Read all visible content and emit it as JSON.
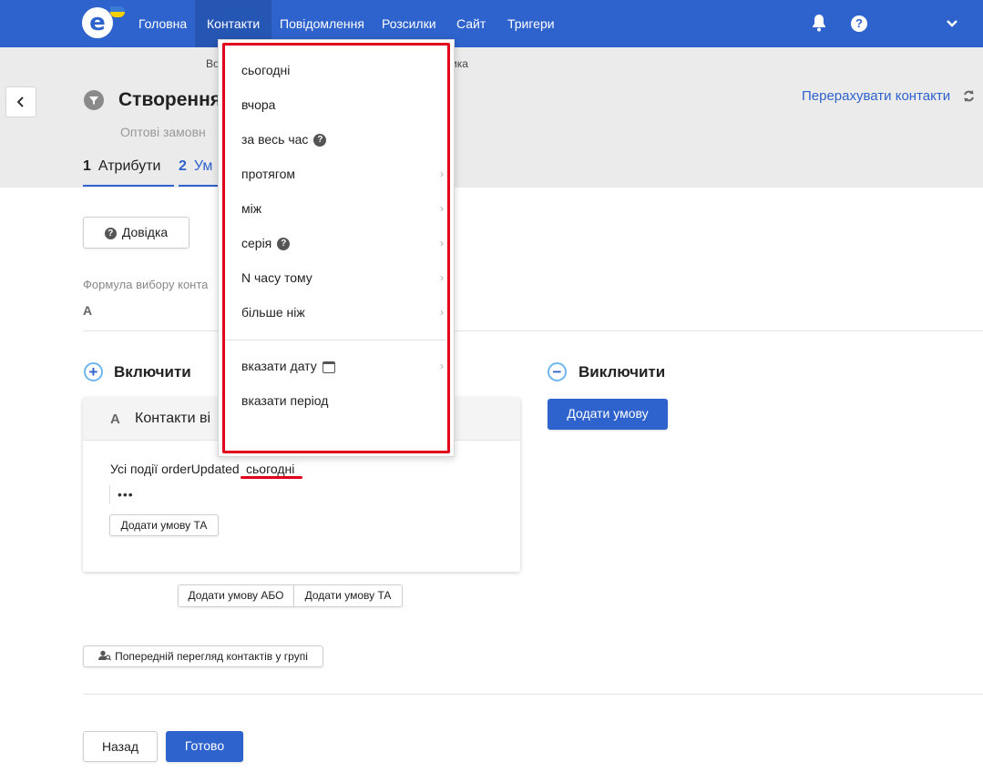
{
  "nav": {
    "items": [
      {
        "label": "Головна",
        "active": false
      },
      {
        "label": "Контакти",
        "active": true
      },
      {
        "label": "Повідомлення",
        "active": false
      },
      {
        "label": "Розсилки",
        "active": false
      },
      {
        "label": "Сайт",
        "active": false
      },
      {
        "label": "Тригери",
        "active": false
      }
    ],
    "icons": [
      "bell-icon",
      "help-icon",
      "chevron-down-icon"
    ]
  },
  "breadcrumb": {
    "left": "Во",
    "right": "ика"
  },
  "header": {
    "title": "Створення",
    "subtitle": "Оптові замовн",
    "recalc_label": "Перерахувати контакти"
  },
  "steps": [
    {
      "num": "1",
      "label": "Атрибути"
    },
    {
      "num": "2",
      "label": "Ум"
    }
  ],
  "body": {
    "help_button": "Довідка",
    "formula_label": "Формула вибору конта",
    "formula_value": "A",
    "include_title": "Включити",
    "exclude_title": "Виключити",
    "exclude_add_button": "Додати умову",
    "card": {
      "letter": "A",
      "title": "Контакти ві",
      "condition_text": "Усі події orderUpdated",
      "condition_value": "сьогодні",
      "dots": "•••",
      "add_and_button": "Додати умову ТА"
    },
    "add_or_button": "Додати умову АБО",
    "add_and_button": "Додати умову ТА",
    "preview_button": "Попередній перегляд контактів у групі",
    "back_button": "Назад",
    "done_button": "Готово"
  },
  "dropdown": {
    "items": [
      {
        "label": "сьогодні",
        "arrow": false,
        "help": false
      },
      {
        "label": "вчора",
        "arrow": false,
        "help": false
      },
      {
        "label": "за весь час",
        "arrow": false,
        "help": true
      },
      {
        "label": "протягом",
        "arrow": true,
        "help": false
      },
      {
        "label": "між",
        "arrow": true,
        "help": false
      },
      {
        "label": "серія",
        "arrow": true,
        "help": true
      },
      {
        "label": "N часу тому",
        "arrow": true,
        "help": false
      },
      {
        "label": "більше ніж",
        "arrow": true,
        "help": false
      }
    ],
    "extra_items": [
      {
        "label": "вказати дату",
        "arrow": true,
        "icon": "calendar-icon"
      },
      {
        "label": "вказати період",
        "arrow": false
      }
    ]
  },
  "colors": {
    "brand": "#2e62cc",
    "highlight": "#e0001b",
    "header_bg": "#ebebeb"
  }
}
